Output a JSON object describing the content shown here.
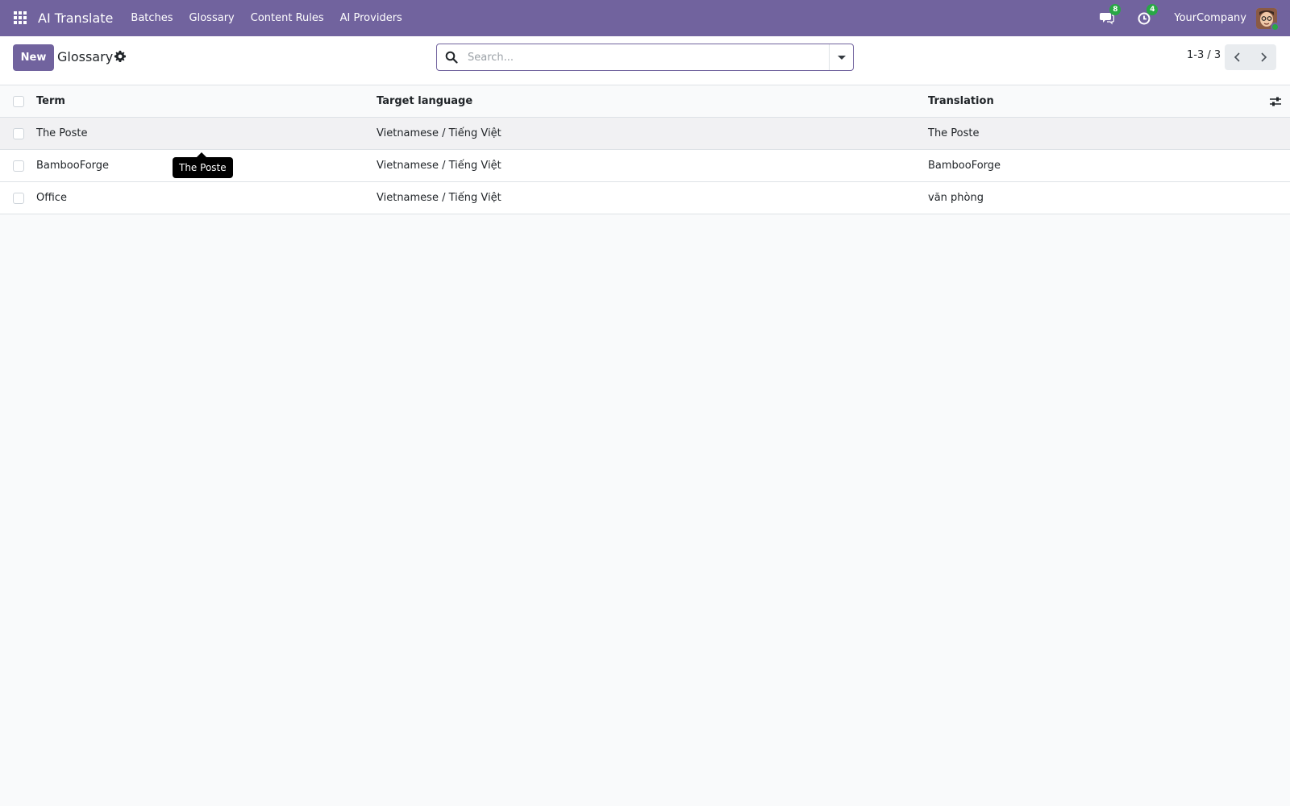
{
  "navbar": {
    "app_name": "AI Translate",
    "menu": [
      {
        "label": "Batches"
      },
      {
        "label": "Glossary"
      },
      {
        "label": "Content Rules"
      },
      {
        "label": "AI Providers"
      }
    ],
    "messages_count": "8",
    "activities_count": "4",
    "company": "YourCompany",
    "color": "#71639e"
  },
  "control_panel": {
    "new_label": "New",
    "title": "Glossary",
    "search_placeholder": "Search...",
    "pager": "1-3 / 3"
  },
  "table": {
    "columns": {
      "term": "Term",
      "target_language": "Target language",
      "translation": "Translation"
    },
    "rows": [
      {
        "term": "The Poste",
        "target_language": "Vietnamese / Tiếng Việt",
        "translation": "The Poste"
      },
      {
        "term": "BambooForge",
        "target_language": "Vietnamese / Tiếng Việt",
        "translation": "BambooForge"
      },
      {
        "term": "Office",
        "target_language": "Vietnamese / Tiếng Việt",
        "translation": "văn phòng"
      }
    ]
  },
  "tooltip": {
    "text": "The Poste"
  }
}
